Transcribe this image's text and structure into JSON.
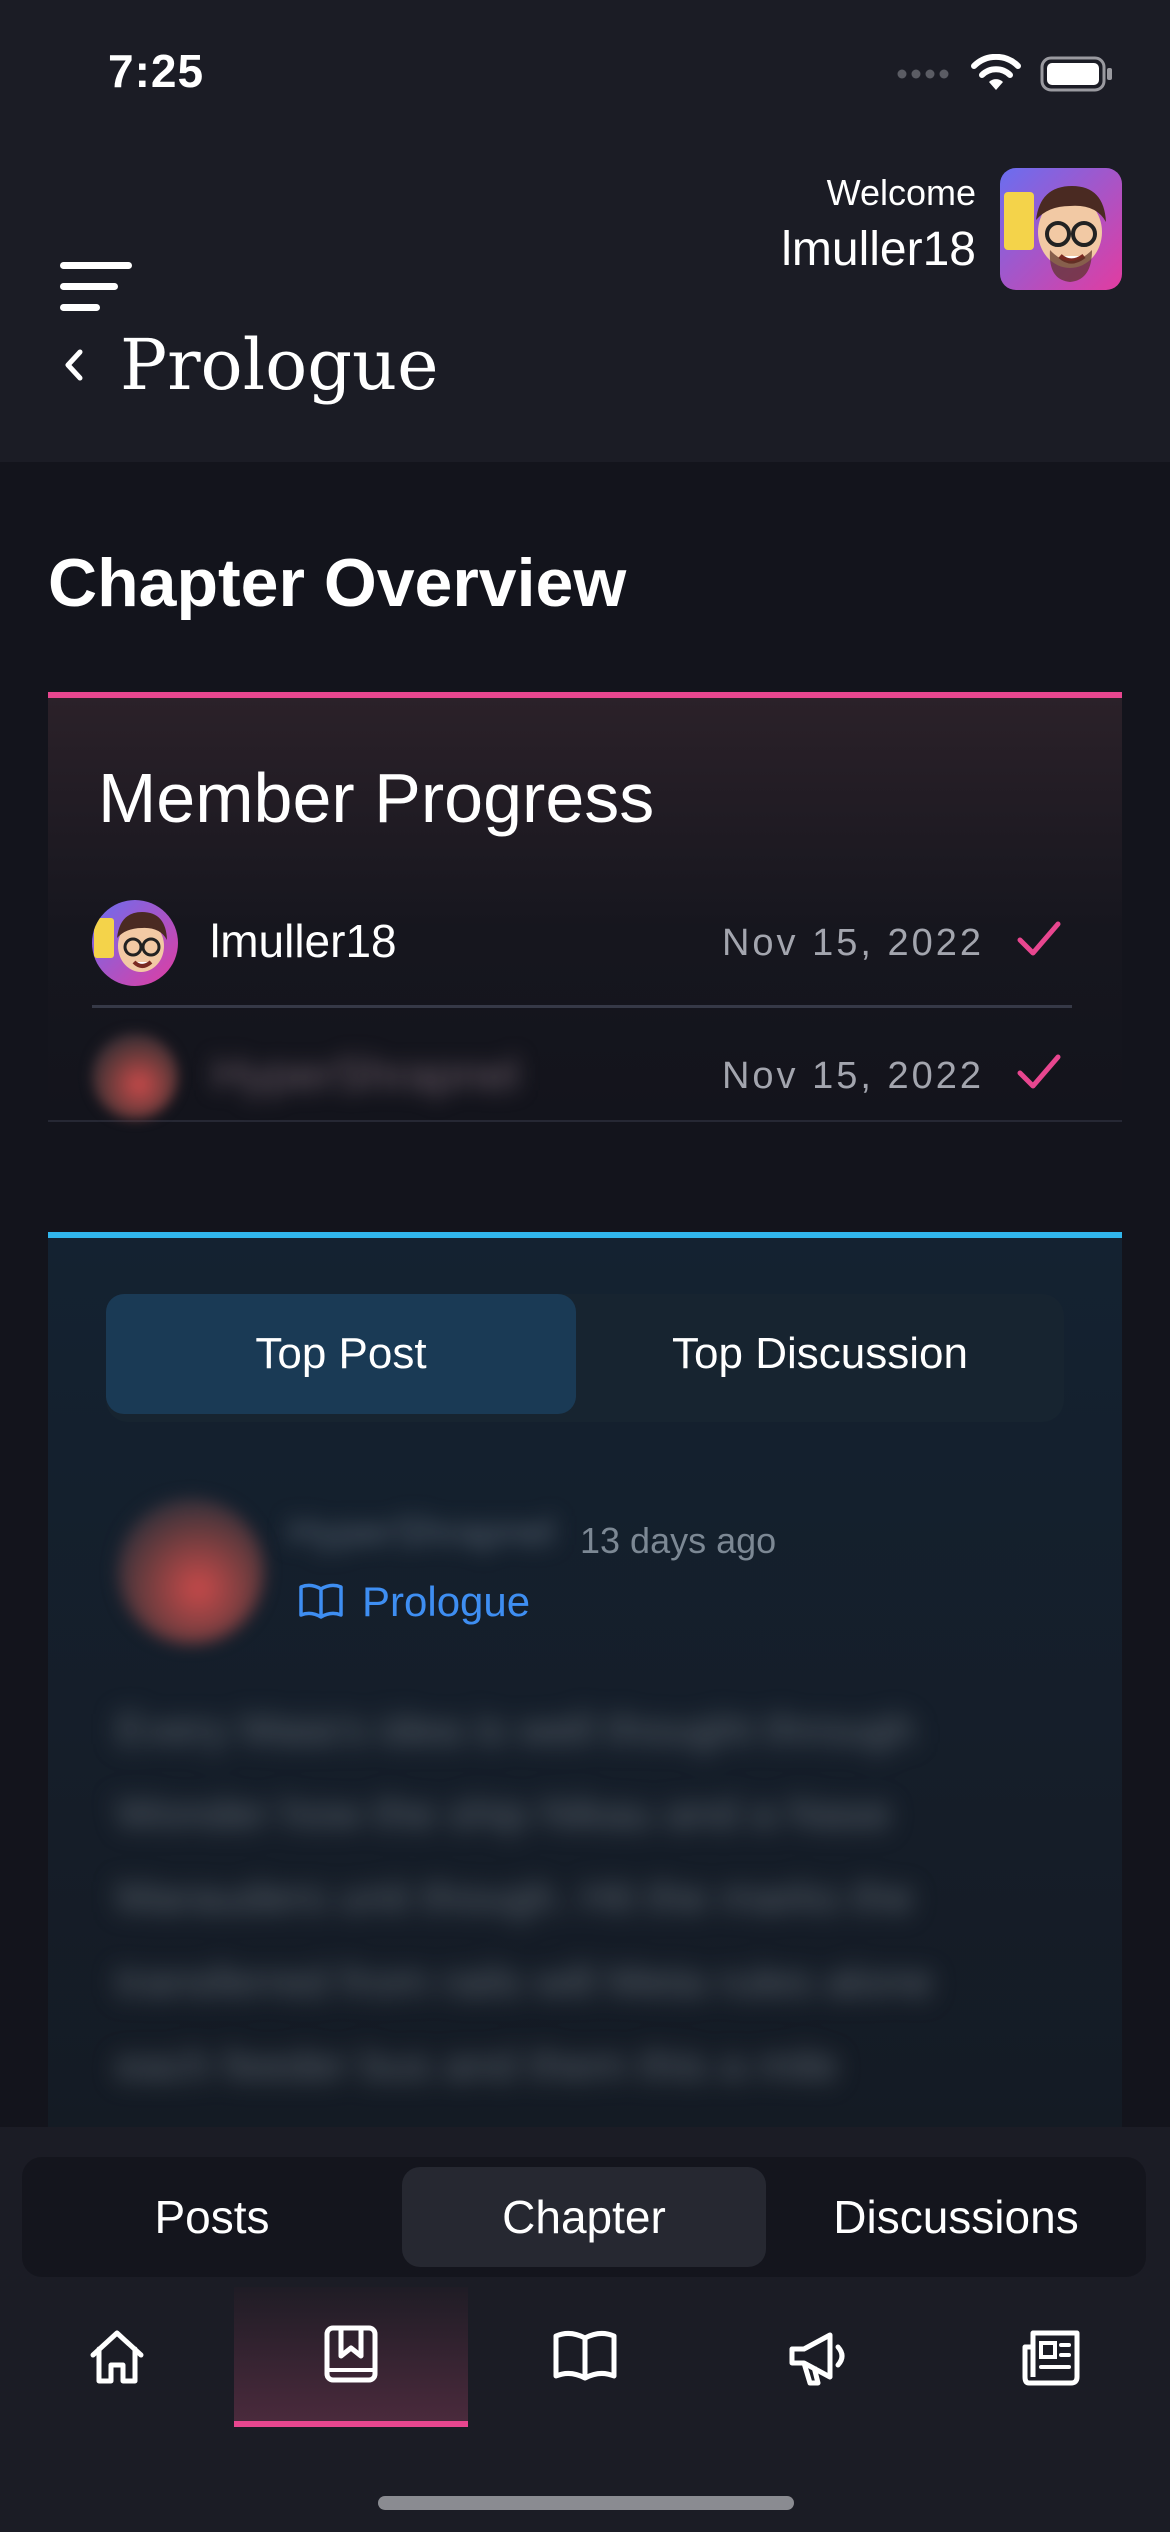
{
  "status_bar": {
    "time": "7:25"
  },
  "header": {
    "welcome_label": "Welcome",
    "username": "lmuller18",
    "page_title": "Prologue"
  },
  "chapter_overview": {
    "title": "Chapter Overview",
    "member_progress": {
      "title": "Member Progress",
      "members": [
        {
          "name": "lmuller18",
          "date": "Nov 15, 2022",
          "completed": true
        },
        {
          "name": "HyperShrapnel",
          "date": "Nov 15, 2022",
          "completed": true
        }
      ]
    }
  },
  "top_post": {
    "tabs": [
      "Top Post",
      "Top Discussion"
    ],
    "active_tab": "Top Post",
    "author": "HyperShrapnel",
    "time_ago": "13 days ago",
    "chapter": "Prologue",
    "body_lines": [
      "Every Maia's idea is well thought through",
      "Wonder how the ship Nikau and a Nase",
      "Marauders unit though. Hit the marks the",
      "transferred from rails will Meta rules alone",
      "each feeder bus and them this a mile"
    ]
  },
  "sub_tabs": [
    "Posts",
    "Chapter",
    "Discussions"
  ],
  "active_sub_tab": "Chapter",
  "bottom_nav": [
    {
      "icon": "home-icon"
    },
    {
      "icon": "bookmark-book-icon",
      "active": true
    },
    {
      "icon": "open-book-icon"
    },
    {
      "icon": "megaphone-icon"
    },
    {
      "icon": "newspaper-icon"
    }
  ],
  "colors": {
    "accent_pink": "#e8468f",
    "accent_blue": "#31b6ec",
    "link_blue": "#3e8ef2",
    "background": "#13141c",
    "surface": "#1b1c25"
  }
}
